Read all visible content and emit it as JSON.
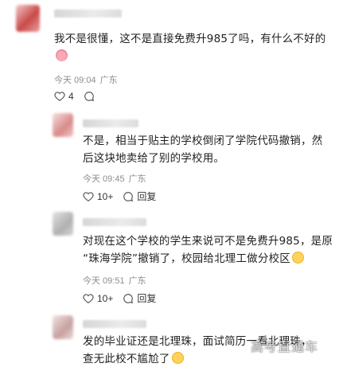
{
  "comments": [
    {
      "text_lines": [
        "我不是很懂，这不是直接免费升985了吗，有什么不好的"
      ],
      "time": "今天 09:04",
      "location": "广东",
      "likes": "4",
      "reply_label": "",
      "emoji": "pig-face-emoji"
    },
    {
      "text_lines": [
        "不是，相当于贴主的学校倒闭了学院代码撤销，然",
        "后这块地卖给了别的学校用。"
      ],
      "time": "今天 09:45",
      "location": "广东",
      "likes": "10+",
      "reply_label": "回复"
    },
    {
      "text_lines": [
        "对现在这个学校的学生来说可不是免费升985，是原",
        "“珠海学院”撤销了，校园给北理工做分校区"
      ],
      "time": "今天 09:51",
      "location": "广东",
      "likes": "10+",
      "reply_label": "回复",
      "emoji": "face-emoji"
    },
    {
      "text_lines": [
        "发的毕业证还是北理珠，面试简历一看北理珠，",
        "查无此校不尴尬了"
      ],
      "emoji": "face-emoji"
    }
  ],
  "watermark": "高考直通车",
  "icons": {
    "like": "heart-icon",
    "comment": "comment-bubble-icon"
  }
}
